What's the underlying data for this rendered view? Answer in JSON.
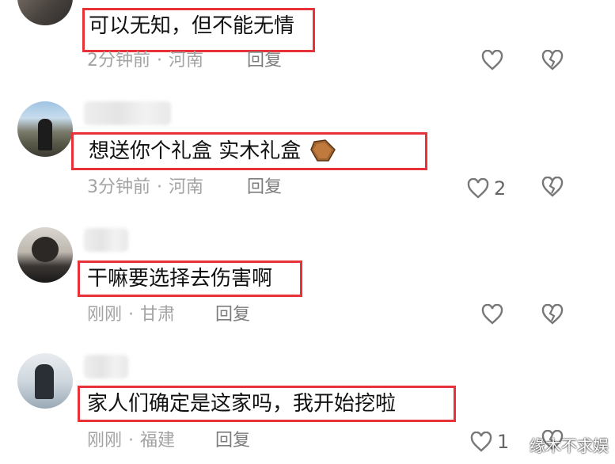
{
  "comments": [
    {
      "content": "可以无知，但不能无情",
      "time": "2分钟前",
      "location": "河南",
      "reply": "回复",
      "likes": ""
    },
    {
      "content": "想送你个礼盒    实木礼盒",
      "time": "3分钟前",
      "location": "河南",
      "reply": "回复",
      "likes": "2"
    },
    {
      "content": "干嘛要选择去伤害啊",
      "time": "刚刚",
      "location": "甘肃",
      "reply": "回复",
      "likes": ""
    },
    {
      "content": "家人们确定是这家吗，我开始挖啦",
      "time": "刚刚",
      "location": "福建",
      "reply": "回复",
      "likes": "1"
    }
  ],
  "separator": "·",
  "watermark": "缘木不求娱",
  "colors": {
    "highlight": "#e8323a",
    "meta": "#a3a3a3",
    "reply": "#7d7d7d"
  },
  "icons": {
    "like": "heart-outline-icon",
    "dislike": "broken-heart-icon",
    "emoji": "coffin-emoji-icon"
  }
}
